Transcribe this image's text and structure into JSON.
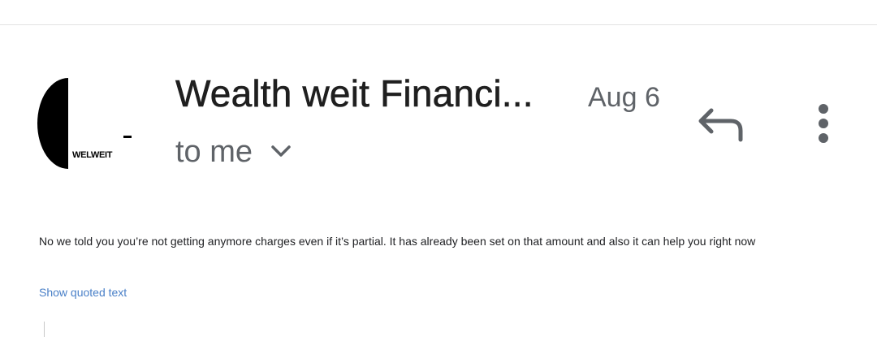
{
  "message": {
    "sender_name": "Wealth weit Financi...",
    "date": "Aug 6",
    "recipient_label": "to me",
    "avatar_logo_text": "WELWEIT",
    "body": "No we told you you’re not getting anymore charges even if it’s partial. It has already been set on that amount and also it can help you right now",
    "show_quoted_label": "Show quoted text"
  },
  "icons": {
    "reply": "reply-icon",
    "more": "more-vert-icon",
    "expand": "chevron-down-icon"
  },
  "colors": {
    "sender_text": "#1f1f1f",
    "secondary_text": "#5f6368",
    "link": "#4a80c8",
    "icon": "#5f6368"
  }
}
